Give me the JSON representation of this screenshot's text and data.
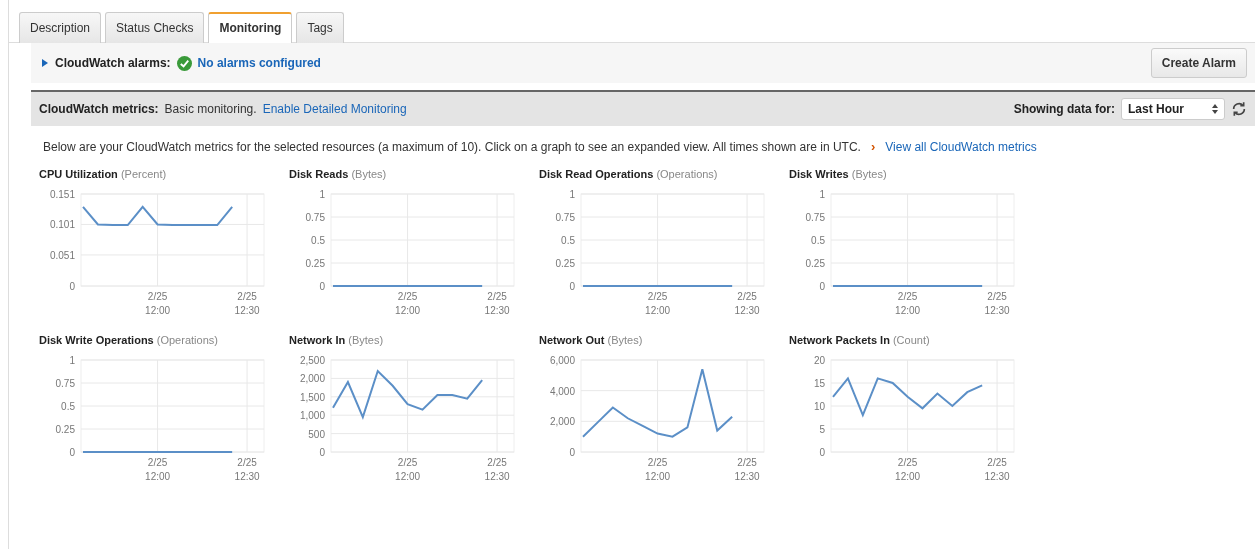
{
  "tabs": [
    {
      "label": "Description",
      "selected": false
    },
    {
      "label": "Status Checks",
      "selected": false
    },
    {
      "label": "Monitoring",
      "selected": true
    },
    {
      "label": "Tags",
      "selected": false
    }
  ],
  "alarms": {
    "expanded": false,
    "label": "CloudWatch alarms:",
    "status": "No alarms configured",
    "button": "Create Alarm"
  },
  "metrics_bar": {
    "label": "CloudWatch metrics:",
    "text": "Basic monitoring.",
    "link": "Enable Detailed Monitoring",
    "range_label": "Showing data for:",
    "range_value": "Last Hour"
  },
  "intro": {
    "text": "Below are your CloudWatch metrics for the selected resources (a maximum of 10). Click on a graph to see an expanded view. All times shown are in UTC.",
    "arrow": "›",
    "link": "View all CloudWatch metrics"
  },
  "charts": [
    {
      "unit": "(Percent)",
      "chart_data": {
        "type": "line",
        "grid": true,
        "categories": [
          null,
          null,
          null,
          null,
          null,
          "2/25 12:00",
          null,
          null,
          null,
          null,
          null,
          "2/25 12:30",
          null
        ],
        "series": [
          {
            "name": "CPU Utilization",
            "color": "#5b8fc7",
            "values": [
              0.13,
              0.101,
              0.1,
              0.1,
              0.13,
              0.101,
              0.1,
              0.1,
              0.1,
              0.1,
              0.13,
              null,
              null
            ]
          }
        ],
        "ylim": [
          0,
          0.151
        ],
        "yticks": [
          0,
          0.051,
          0.101,
          0.151
        ]
      }
    },
    {
      "unit": "(Bytes)",
      "chart_data": {
        "type": "line",
        "grid": true,
        "categories": [
          null,
          null,
          null,
          null,
          null,
          "2/25 12:00",
          null,
          null,
          null,
          null,
          null,
          "2/25 12:30",
          null
        ],
        "series": [
          {
            "name": "Disk Reads",
            "color": "#5b8fc7",
            "values": [
              0,
              0,
              0,
              0,
              0,
              0,
              0,
              0,
              0,
              0,
              0,
              null,
              null
            ]
          }
        ],
        "ylim": [
          0,
          1
        ],
        "yticks": [
          0,
          0.25,
          0.5,
          0.75,
          1
        ]
      }
    },
    {
      "unit": "(Operations)",
      "chart_data": {
        "type": "line",
        "grid": true,
        "categories": [
          null,
          null,
          null,
          null,
          null,
          "2/25 12:00",
          null,
          null,
          null,
          null,
          null,
          "2/25 12:30",
          null
        ],
        "series": [
          {
            "name": "Disk Read Operations",
            "color": "#5b8fc7",
            "values": [
              0,
              0,
              0,
              0,
              0,
              0,
              0,
              0,
              0,
              0,
              0,
              null,
              null
            ]
          }
        ],
        "ylim": [
          0,
          1
        ],
        "yticks": [
          0,
          0.25,
          0.5,
          0.75,
          1
        ]
      }
    },
    {
      "unit": "(Bytes)",
      "chart_data": {
        "type": "line",
        "grid": true,
        "categories": [
          null,
          null,
          null,
          null,
          null,
          "2/25 12:00",
          null,
          null,
          null,
          null,
          null,
          "2/25 12:30",
          null
        ],
        "series": [
          {
            "name": "Disk Writes",
            "color": "#5b8fc7",
            "values": [
              0,
              0,
              0,
              0,
              0,
              0,
              0,
              0,
              0,
              0,
              0,
              null,
              null
            ]
          }
        ],
        "ylim": [
          0,
          1
        ],
        "yticks": [
          0,
          0.25,
          0.5,
          0.75,
          1
        ]
      }
    },
    {
      "unit": "(Operations)",
      "chart_data": {
        "type": "line",
        "grid": true,
        "categories": [
          null,
          null,
          null,
          null,
          null,
          "2/25 12:00",
          null,
          null,
          null,
          null,
          null,
          "2/25 12:30",
          null
        ],
        "series": [
          {
            "name": "Disk Write Operations",
            "color": "#5b8fc7",
            "values": [
              0,
              0,
              0,
              0,
              0,
              0,
              0,
              0,
              0,
              0,
              0,
              null,
              null
            ]
          }
        ],
        "ylim": [
          0,
          1
        ],
        "yticks": [
          0,
          0.25,
          0.5,
          0.75,
          1
        ]
      }
    },
    {
      "unit": "(Bytes)",
      "chart_data": {
        "type": "line",
        "grid": true,
        "categories": [
          null,
          null,
          null,
          null,
          null,
          "2/25 12:00",
          null,
          null,
          null,
          null,
          null,
          "2/25 12:30",
          null
        ],
        "series": [
          {
            "name": "Network In",
            "color": "#5b8fc7",
            "values": [
              1200,
              1900,
              950,
              2200,
              1800,
              1300,
              1150,
              1550,
              1550,
              1450,
              1950,
              null,
              null
            ]
          }
        ],
        "ylim": [
          0,
          2500
        ],
        "yticks": [
          {
            "value": 0,
            "label": "0"
          },
          {
            "value": 500,
            "label": "500"
          },
          {
            "value": 1000,
            "label": "1,000"
          },
          {
            "value": 1500,
            "label": "1,500"
          },
          {
            "value": 2000,
            "label": "2,000"
          },
          {
            "value": 2500,
            "label": "2,500"
          }
        ]
      }
    },
    {
      "unit": "(Bytes)",
      "chart_data": {
        "type": "line",
        "grid": true,
        "categories": [
          null,
          null,
          null,
          null,
          null,
          "2/25 12:00",
          null,
          null,
          null,
          null,
          null,
          "2/25 12:30",
          null
        ],
        "series": [
          {
            "name": "Network Out",
            "color": "#5b8fc7",
            "values": [
              1000,
              1950,
              2900,
              2200,
              1700,
              1200,
              1000,
              1600,
              5400,
              1400,
              2300,
              null,
              null
            ]
          }
        ],
        "ylim": [
          0,
          6000
        ],
        "yticks": [
          {
            "value": 0,
            "label": "0"
          },
          {
            "value": 2000,
            "label": "2,000"
          },
          {
            "value": 4000,
            "label": "4,000"
          },
          {
            "value": 6000,
            "label": "6,000"
          }
        ]
      }
    },
    {
      "unit": "(Count)",
      "chart_data": {
        "type": "line",
        "grid": true,
        "categories": [
          null,
          null,
          null,
          null,
          null,
          "2/25 12:00",
          null,
          null,
          null,
          null,
          null,
          "2/25 12:30",
          null
        ],
        "series": [
          {
            "name": "Network Packets In",
            "color": "#5b8fc7",
            "values": [
              12,
              16,
              8,
              16,
              15,
              12,
              9.5,
              12.7,
              10,
              13,
              14.5,
              null,
              null
            ]
          }
        ],
        "ylim": [
          0,
          20
        ],
        "yticks": [
          0,
          5,
          10,
          15,
          20
        ]
      }
    }
  ]
}
